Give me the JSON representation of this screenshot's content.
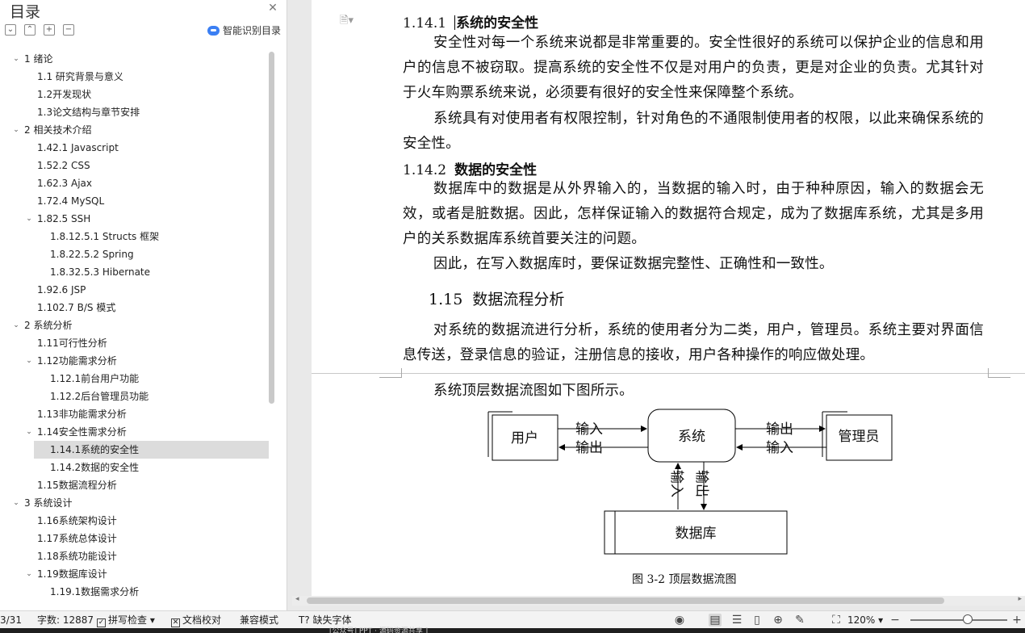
{
  "toc": {
    "title": "目录",
    "smart_label": "智能识别目录",
    "items": [
      {
        "level": 1,
        "arrow": "⌄",
        "text": "1 绪论"
      },
      {
        "level": 2,
        "arrow": "",
        "text": "1.1  研究背景与意义"
      },
      {
        "level": 2,
        "arrow": "",
        "text": "1.2开发现状"
      },
      {
        "level": 2,
        "arrow": "",
        "text": "1.3论文结构与章节安排"
      },
      {
        "level": 1,
        "arrow": "⌄",
        "text": "2  相关技术介绍"
      },
      {
        "level": 2,
        "arrow": "",
        "text": "1.42.1 Javascript"
      },
      {
        "level": 2,
        "arrow": "",
        "text": "1.52.2 CSS"
      },
      {
        "level": 2,
        "arrow": "",
        "text": "1.62.3 Ajax"
      },
      {
        "level": 2,
        "arrow": "",
        "text": "1.72.4 MySQL"
      },
      {
        "level": 2,
        "arrow": "⌄",
        "text": "1.82.5 SSH"
      },
      {
        "level": 3,
        "arrow": "",
        "text": "1.8.12.5.1 Structs 框架"
      },
      {
        "level": 3,
        "arrow": "",
        "text": "1.8.22.5.2 Spring"
      },
      {
        "level": 3,
        "arrow": "",
        "text": "1.8.32.5.3 Hibernate"
      },
      {
        "level": 2,
        "arrow": "",
        "text": "1.92.6 JSP"
      },
      {
        "level": 2,
        "arrow": "",
        "text": "1.102.7 B/S 模式"
      },
      {
        "level": 1,
        "arrow": "⌄",
        "text": "2  系统分析"
      },
      {
        "level": 2,
        "arrow": "",
        "text": "1.11可行性分析"
      },
      {
        "level": 2,
        "arrow": "⌄",
        "text": "1.12功能需求分析"
      },
      {
        "level": 3,
        "arrow": "",
        "text": "1.12.1前台用户功能"
      },
      {
        "level": 3,
        "arrow": "",
        "text": "1.12.2后台管理员功能"
      },
      {
        "level": 2,
        "arrow": "",
        "text": "1.13非功能需求分析"
      },
      {
        "level": 2,
        "arrow": "⌄",
        "text": "1.14安全性需求分析"
      },
      {
        "level": 3,
        "arrow": "",
        "text": "1.14.1系统的安全性",
        "active": true
      },
      {
        "level": 3,
        "arrow": "",
        "text": "1.14.2数据的安全性"
      },
      {
        "level": 2,
        "arrow": "",
        "text": "1.15数据流程分析"
      },
      {
        "level": 1,
        "arrow": "⌄",
        "text": "3  系统设计"
      },
      {
        "level": 2,
        "arrow": "",
        "text": "1.16系统架构设计"
      },
      {
        "level": 2,
        "arrow": "",
        "text": "1.17系统总体设计"
      },
      {
        "level": 2,
        "arrow": "",
        "text": "1.18系统功能设计"
      },
      {
        "level": 2,
        "arrow": "⌄",
        "text": "1.19数据库设计"
      },
      {
        "level": 3,
        "arrow": "",
        "text": "1.19.1数据需求分析"
      }
    ]
  },
  "doc": {
    "h1_num": "1.14.1",
    "h1_text": "系统的安全性",
    "p1": "安全性对每一个系统来说都是非常重要的。安全性很好的系统可以保护企业的信息和用户的信息不被窃取。提高系统的安全性不仅是对用户的负责，更是对企业的负责。尤其针对于火车购票系统来说，必须要有很好的安全性来保障整个系统。",
    "p2": "系统具有对使用者有权限控制，针对角色的不通限制使用者的权限，以此来确保系统的安全性。",
    "h2_num": "1.14.2",
    "h2_text": "数据的安全性",
    "p3": "数据库中的数据是从外界输入的，当数据的输入时，由于种种原因，输入的数据会无效，或者是脏数据。因此，怎样保证输入的数据符合规定，成为了数据库系统，尤其是多用户的关系数据库系统首要关注的问题。",
    "p4": "因此，在写入数据库时，要保证数据完整性、正确性和一致性。",
    "h3_num": "1.15",
    "h3_text": "数据流程分析",
    "p5": "对系统的数据流进行分析，系统的使用者分为二类，用户，管理员。系统主要对界面信息传送，登录信息的验证，注册信息的接收，用户各种操作的响应做处理。",
    "p6": "系统顶层数据流图如下图所示。",
    "caption": "图 3-2  顶层数据流图"
  },
  "diagram": {
    "user": "用户",
    "system": "系统",
    "admin": "管理员",
    "database": "数据库",
    "input": "输入",
    "output": "输出"
  },
  "status": {
    "page": "3/31",
    "words": "字数: 12887",
    "spell": "拼写检查",
    "proof": "文档校对",
    "compat": "兼容模式",
    "missing_font": "缺失字体",
    "zoom": "120%",
    "bottom_text": "[公众号] PPT · 源码资源共享 ]"
  }
}
